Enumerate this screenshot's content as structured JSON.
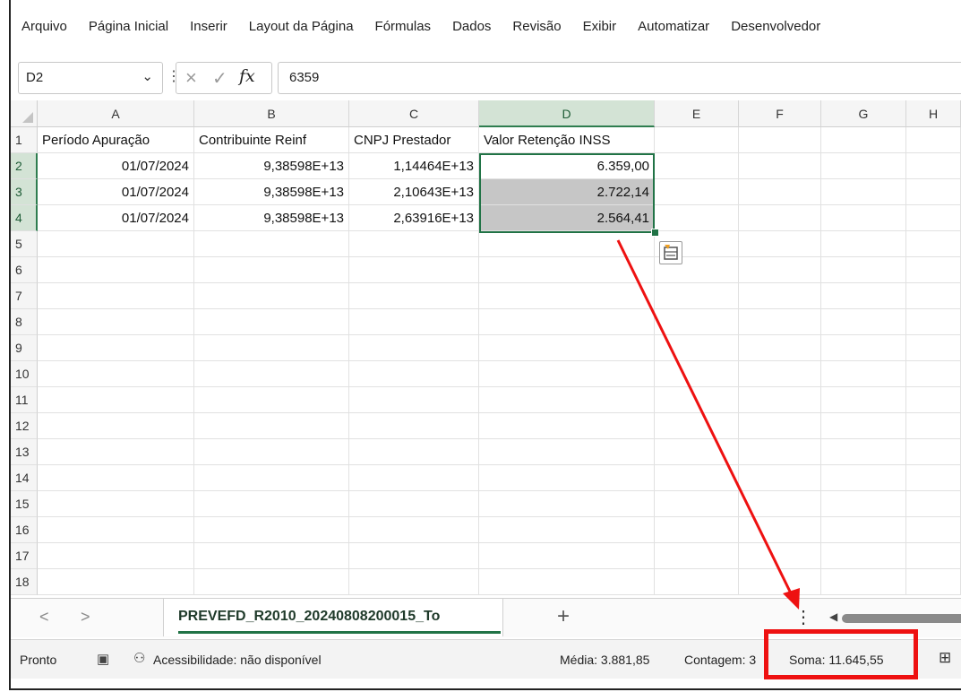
{
  "ribbon": {
    "items": [
      "Arquivo",
      "Página Inicial",
      "Inserir",
      "Layout da Página",
      "Fórmulas",
      "Dados",
      "Revisão",
      "Exibir",
      "Automatizar",
      "Desenvolvedor"
    ]
  },
  "formula_bar": {
    "name_box": "D2",
    "formula": "6359",
    "fx_label": "fx"
  },
  "sheet": {
    "columns": [
      "A",
      "B",
      "C",
      "D",
      "E",
      "F",
      "G",
      "H"
    ],
    "selected_column": "D",
    "rows": [
      "1",
      "2",
      "3",
      "4",
      "5",
      "6",
      "7",
      "8",
      "9",
      "10",
      "11",
      "12",
      "13",
      "14",
      "15",
      "16",
      "17",
      "18"
    ],
    "selected_rows": [
      "2",
      "3",
      "4"
    ],
    "cells": {
      "A1": "Período Apuração",
      "B1": "Contribuinte Reinf",
      "C1": "CNPJ Prestador",
      "D1": "Valor Retenção INSS",
      "A2": "01/07/2024",
      "B2": "9,38598E+13",
      "C2": "1,14464E+13",
      "D2": "6.359,00",
      "A3": "01/07/2024",
      "B3": "9,38598E+13",
      "C3": "2,10643E+13",
      "D3": "2.722,14",
      "A4": "01/07/2024",
      "B4": "9,38598E+13",
      "C4": "2,63916E+13",
      "D4": "2.564,41"
    }
  },
  "tabs": {
    "sheet_name": "PREVEFD_R2010_20240808200015_To",
    "add_symbol": "+",
    "prev_symbol": "<",
    "next_symbol": ">",
    "menu_symbol": "⋮"
  },
  "status": {
    "ready": "Pronto",
    "accessibility": "Acessibilidade: não disponível",
    "average": "Média: 3.881,85",
    "count": "Contagem: 3",
    "sum": "Soma: 11.645,55"
  },
  "annotation": {
    "arrow_color": "#ee1111",
    "highlight_color": "#ee1111"
  },
  "colors": {
    "selection_green": "#217346",
    "selected_fill": "#c6c6c6"
  }
}
